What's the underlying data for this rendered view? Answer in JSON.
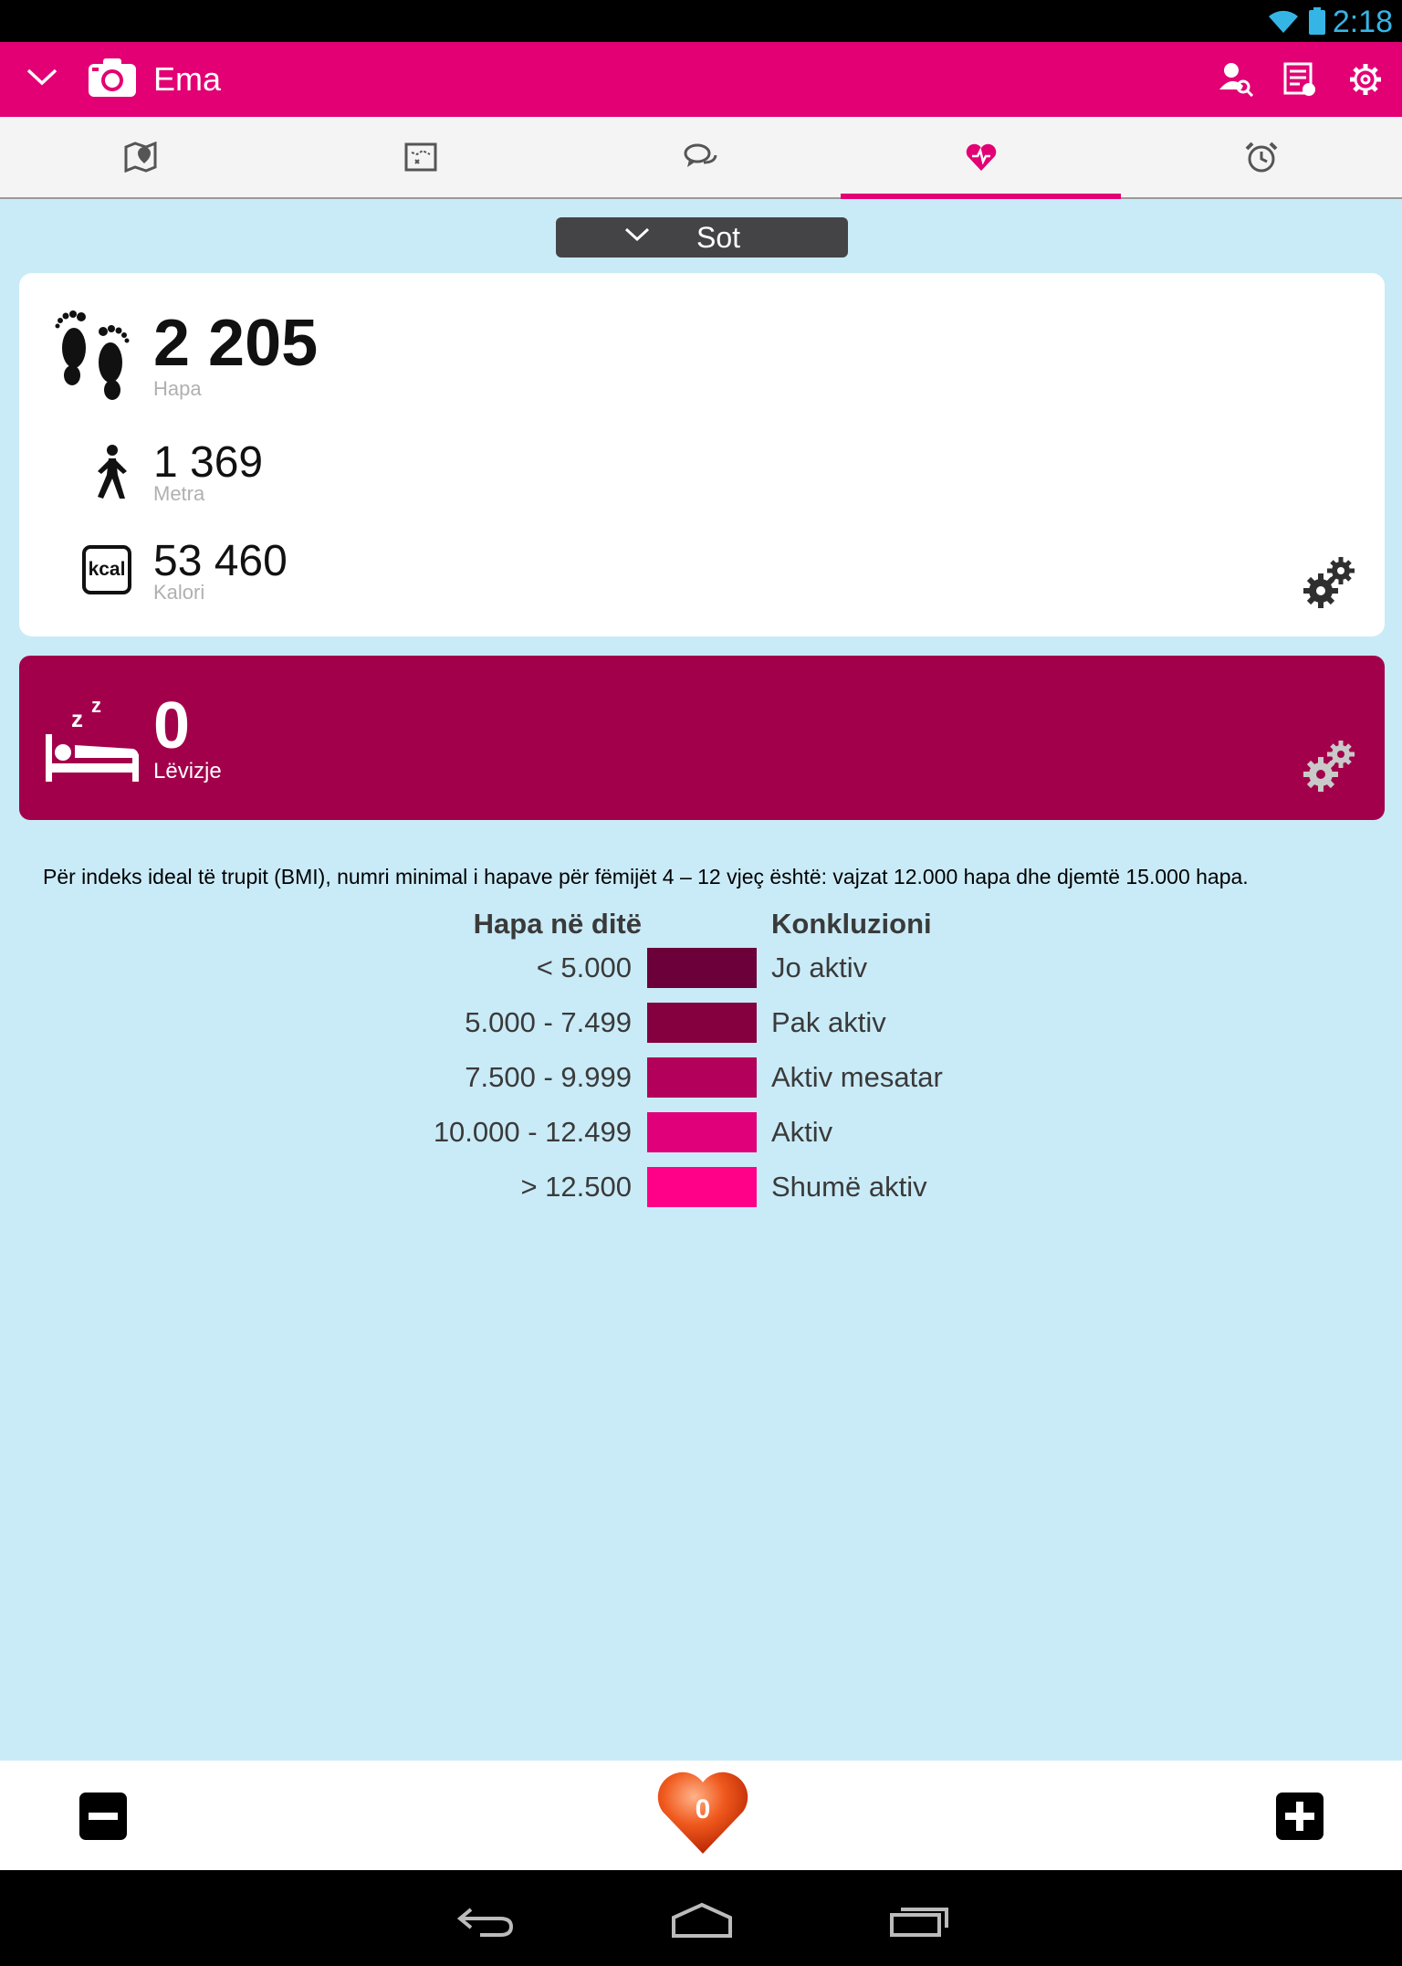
{
  "status_bar": {
    "time": "2:18",
    "icons": [
      "wifi-icon",
      "battery-icon"
    ]
  },
  "app_bar": {
    "title": "Ema",
    "icons": [
      "chevron-down-icon",
      "camera-icon",
      "person-search-icon",
      "list-icon",
      "gear-icon"
    ],
    "color": "#e20074"
  },
  "tabs": [
    {
      "icon": "map-pin-icon",
      "selected": false
    },
    {
      "icon": "treasure-map-icon",
      "selected": false
    },
    {
      "icon": "chat-icon",
      "selected": false
    },
    {
      "icon": "heart-pulse-icon",
      "selected": true
    },
    {
      "icon": "alarm-clock-icon",
      "selected": false
    }
  ],
  "period_selector": {
    "label": "Sot"
  },
  "activity": {
    "steps": {
      "value": "2 205",
      "label": "Hapa",
      "icon": "footprints-icon"
    },
    "distance": {
      "value": "1 369",
      "label": "Metra",
      "icon": "walking-person-icon"
    },
    "calories": {
      "value": "53 460",
      "label": "Kalori",
      "icon_text": "kcal"
    }
  },
  "sleep": {
    "value": "0",
    "label": "Lëvizje",
    "icon": "sleeping-bed-icon",
    "color": "#a3004b"
  },
  "info": {
    "text": "Për indeks ideal të trupit (BMI), numri minimal i hapave për fëmijët 4 – 12 vjeç është: vajzat 12.000 hapa dhe djemtë 15.000 hapa."
  },
  "legend_table": {
    "header_range": "Hapa në ditë",
    "header_conclusion": "Konkluzioni",
    "rows": [
      {
        "range": "< 5.000",
        "label": "Jo aktiv",
        "color": "#6b003a"
      },
      {
        "range": "5.000 - 7.499",
        "label": "Pak aktiv",
        "color": "#85003f"
      },
      {
        "range": "7.500 - 9.999",
        "label": "Aktiv mesatar",
        "color": "#b2005b"
      },
      {
        "range": "10.000 - 12.499",
        "label": "Aktiv",
        "color": "#e0007a"
      },
      {
        "range": "> 12.500",
        "label": "Shumë aktiv",
        "color": "#ff0088"
      }
    ]
  },
  "bottom_bar": {
    "heart_count": "0",
    "icons": [
      "minus-icon",
      "heart-icon",
      "plus-icon"
    ]
  },
  "nav_bar": {
    "icons": [
      "back-icon",
      "home-icon",
      "recents-icon"
    ]
  }
}
